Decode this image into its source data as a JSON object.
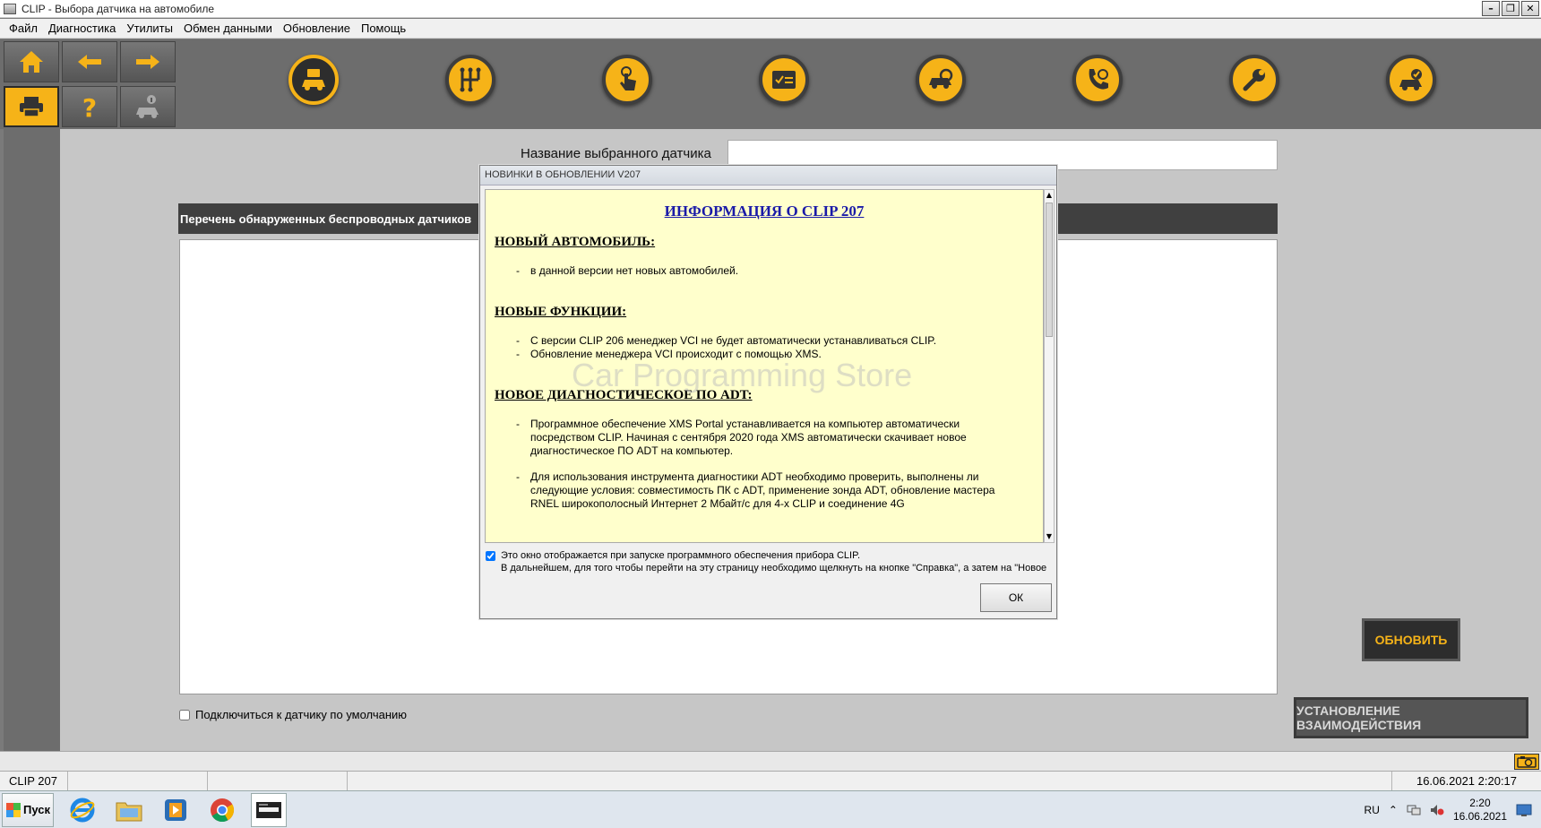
{
  "window": {
    "title": "CLIP - Выбора датчика на автомобиле"
  },
  "menu": [
    "Файл",
    "Диагностика",
    "Утилиты",
    "Обмен данными",
    "Обновление",
    "Помощь"
  ],
  "toolbar": {
    "nav_buttons": [
      "home-icon",
      "arrow-left-icon",
      "arrow-right-icon",
      "printer-icon",
      "help-icon",
      "vehicle-info-icon"
    ],
    "round_buttons": [
      "vehicle-identification-icon",
      "gearbox-icon",
      "touch-icon",
      "checklist-icon",
      "vehicle-scan-icon",
      "phone-support-icon",
      "wrench-icon",
      "vehicle-check-icon"
    ]
  },
  "main": {
    "sensor_label": "Название выбранного датчика",
    "sensor_value": "",
    "list_header": "Перечень обнаруженных беспроводных датчиков",
    "default_checkbox_label": "Подключиться к датчику по умолчанию",
    "refresh_button": "ОБНОВИТЬ",
    "connect_button": "УСТАНОВЛЕНИЕ ВЗАИМОДЕЙСТВИЯ"
  },
  "dialog": {
    "title": "НОВИНКИ В ОБНОВЛЕНИИ V207",
    "info_title": "ИНФОРМАЦИЯ О CLIP 207",
    "sections": [
      {
        "title": "НОВЫЙ АВТОМОБИЛЬ:",
        "items": [
          "в данной версии нет новых автомобилей."
        ]
      },
      {
        "title": "НОВЫЕ ФУНКЦИИ:",
        "items": [
          "С версии CLIP 206 менеджер VCI не будет автоматически устанавливаться CLIP.",
          "Обновление менеджера VCI происходит с помощью XMS."
        ]
      },
      {
        "title": "НОВОЕ ДИАГНОСТИЧЕСКОЕ ПО ADT:",
        "items": [
          "Программное обеспечение XMS Portal устанавливается на компьютер автоматически посредством CLIP. Начиная с сентября 2020 года XMS автоматически скачивает новое диагностическое ПО ADT на компьютер.",
          "Для использования инструмента диагностики ADT необходимо проверить, выполнены ли следующие условия: совместимость ПК с ADT, применение зонда ADT, обновление мастера RNEL широкополосный Интернет 2 Мбайт/с для 4-х CLIP и соединение 4G"
        ]
      }
    ],
    "watermark": "Car Programming Store",
    "checkbox_line1": "Это окно отображается при запуске программного обеспечения прибора CLIP.",
    "checkbox_line2": "В дальнейшем, для того чтобы перейти на эту страницу необходимо щелкнуть на кнопке \"Справка\", а затем на \"Новое",
    "ok_button": "ОК"
  },
  "status": {
    "version": "CLIP 207",
    "datetime": "16.06.2021 2:20:17"
  },
  "taskbar": {
    "start_label": "Пуск",
    "language": "RU",
    "clock_time": "2:20",
    "clock_date": "16.06.2021"
  },
  "colors": {
    "accent": "#f6b318",
    "panel": "#c6c6c6",
    "toolbar": "#6d6d6d",
    "dialog_body": "#ffffcc"
  }
}
